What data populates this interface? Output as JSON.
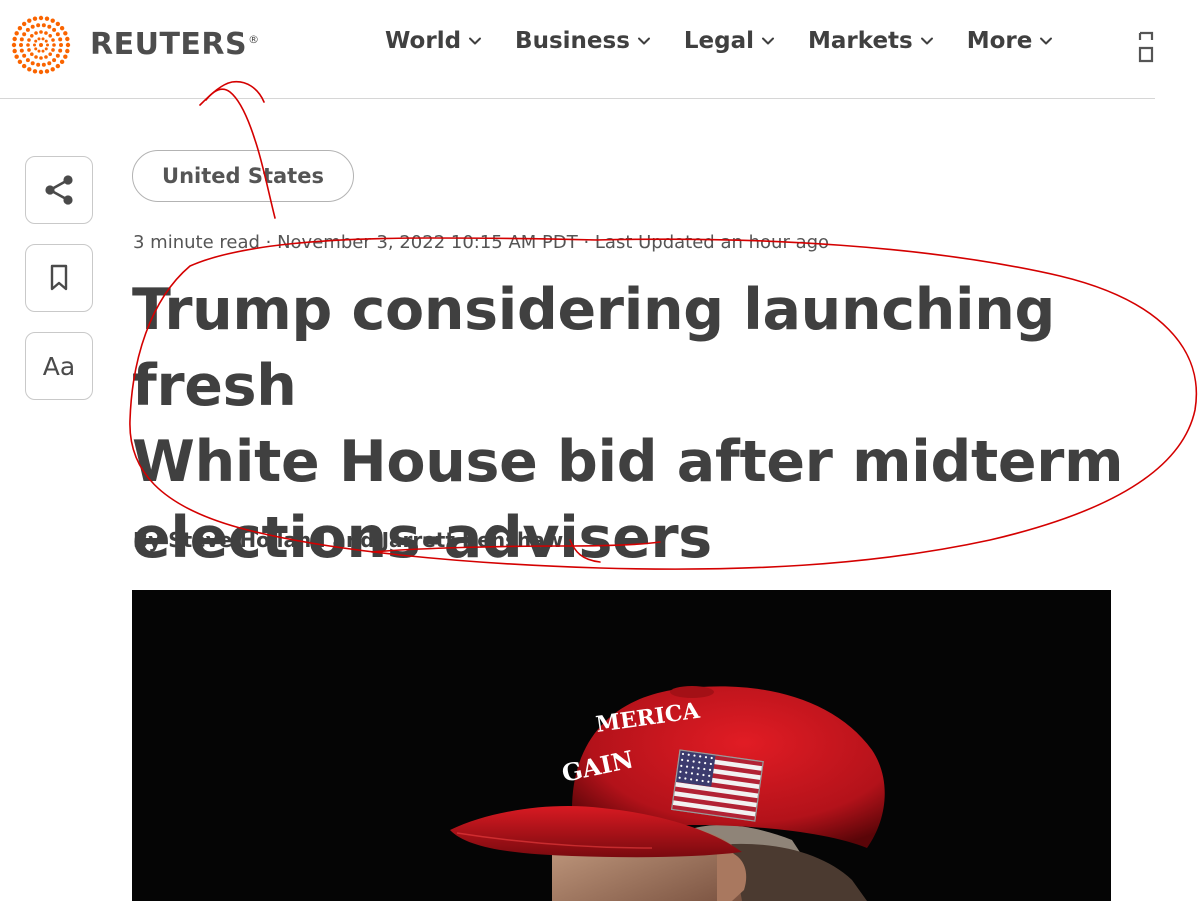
{
  "header": {
    "logo_text": "REUTERS",
    "logo_registered": "®",
    "nav": [
      {
        "label": "World"
      },
      {
        "label": "Business"
      },
      {
        "label": "Legal"
      },
      {
        "label": "Markets"
      },
      {
        "label": "More"
      }
    ]
  },
  "tools": {
    "share_icon": "share-icon",
    "bookmark_icon": "bookmark-icon",
    "text_size_label": "Aa"
  },
  "article": {
    "topic": "United States",
    "meta": "3 minute read · November 3, 2022 10:15 AM PDT · Last Updated an hour ago",
    "headline_lines": [
      "Trump considering launching fresh",
      "White House bid after midterm",
      "elections-advisers"
    ],
    "byline": {
      "prefix": "By ",
      "author_1": "Steve Holland",
      "joiner": " and ",
      "author_2": "Jarrett Renshaw"
    },
    "photo": {
      "cap_text_line_1": "MERICA",
      "cap_text_line_2": "GAIN"
    }
  },
  "colors": {
    "brand_orange": "#fa6400",
    "text_dark": "#404040",
    "ink_red": "#d40000",
    "cap_red": "#c8141c"
  }
}
